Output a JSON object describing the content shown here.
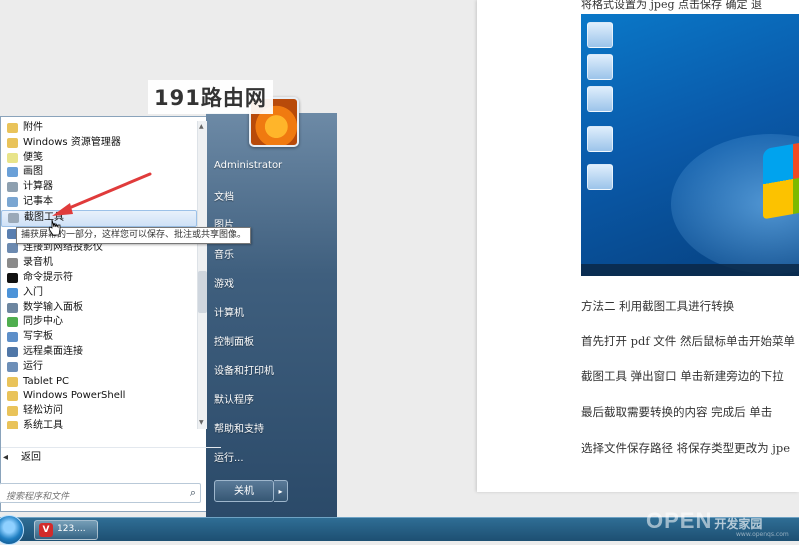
{
  "document": {
    "top_line": "将格式设置为 jpeg   点击保存   确定   退",
    "lines": [
      "方法二   利用截图工具进行转换",
      "首先打开 pdf 文件   然后鼠标单击开始菜单",
      "截图工具   弹出窗口   单击新建旁边的下拉",
      "最后截取需要转换的内容   完成后   单击",
      "选择文件保存路径   将保存类型更改为 jpe"
    ]
  },
  "start_menu": {
    "programs": [
      {
        "label": "附件",
        "icon": "folder-icon",
        "color": "#e9c35a"
      },
      {
        "label": "Windows 资源管理器",
        "icon": "explorer-icon",
        "color": "#e9c35a"
      },
      {
        "label": "便笺",
        "icon": "sticky-notes-icon",
        "color": "#e8e48a"
      },
      {
        "label": "画图",
        "icon": "paint-icon",
        "color": "#6aa0d8"
      },
      {
        "label": "计算器",
        "icon": "calculator-icon",
        "color": "#8ea0b0"
      },
      {
        "label": "记事本",
        "icon": "notepad-icon",
        "color": "#7aa6d2"
      },
      {
        "label": "截图工具",
        "icon": "snipping-tool-icon",
        "color": "#9aa9b8",
        "highlighted": true
      },
      {
        "label": "",
        "icon": "app-icon",
        "color": "#5a7fb0"
      },
      {
        "label": "连接到网络投影仪",
        "icon": "projector-icon",
        "color": "#6c8ab0"
      },
      {
        "label": "录音机",
        "icon": "microphone-icon",
        "color": "#8a8a8a"
      },
      {
        "label": "命令提示符",
        "icon": "cmd-icon",
        "color": "#111111"
      },
      {
        "label": "入门",
        "icon": "getting-started-icon",
        "color": "#4c93d8"
      },
      {
        "label": "数学输入面板",
        "icon": "math-panel-icon",
        "color": "#6d86a0"
      },
      {
        "label": "同步中心",
        "icon": "sync-icon",
        "color": "#4fae4f"
      },
      {
        "label": "写字板",
        "icon": "wordpad-icon",
        "color": "#5d8fc9"
      },
      {
        "label": "远程桌面连接",
        "icon": "remote-desktop-icon",
        "color": "#5077a8"
      },
      {
        "label": "运行",
        "icon": "run-icon",
        "color": "#6d8fb8"
      },
      {
        "label": "Tablet PC",
        "icon": "folder-icon",
        "color": "#e9c35a"
      },
      {
        "label": "Windows PowerShell",
        "icon": "folder-icon",
        "color": "#e9c35a"
      },
      {
        "label": "轻松访问",
        "icon": "folder-icon",
        "color": "#e9c35a"
      },
      {
        "label": "系统工具",
        "icon": "folder-icon",
        "color": "#e9c35a"
      }
    ],
    "back_label": "返回",
    "search_placeholder": "搜索程序和文件",
    "right_items": [
      "Administrator",
      "文档",
      "图片",
      "音乐",
      "游戏",
      "计算机",
      "控制面板",
      "设备和打印机",
      "默认程序",
      "帮助和支持",
      "运行..."
    ],
    "shutdown_label": "关机",
    "tooltip": "捕获屏幕的一部分，这样您可以保存、批注或共享图像。"
  },
  "taskbar": {
    "task_label": "123....",
    "task_app_glyph": "V"
  },
  "watermarks": {
    "top": "191路由网",
    "bottom_brand": "OPEN",
    "bottom_cn": "开发家园",
    "bottom_url": "www.openqs.com"
  }
}
